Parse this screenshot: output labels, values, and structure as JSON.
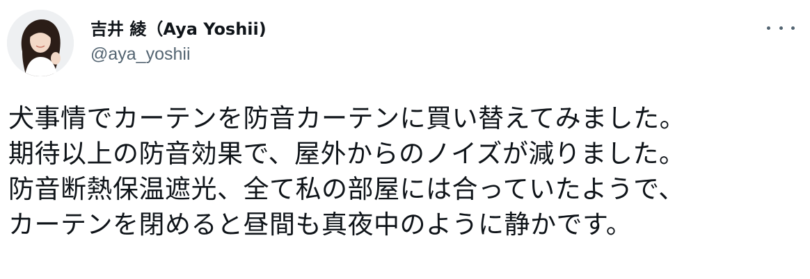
{
  "author": {
    "display_name": "吉井 綾（Aya Yoshii)",
    "handle": "@aya_yoshii"
  },
  "icons": {
    "avatar": "profile-photo",
    "more": "more-horizontal-icon"
  },
  "tweet": {
    "lines": [
      "犬事情でカーテンを防音カーテンに買い替えてみました。",
      "期待以上の防音効果で、屋外からのノイズが減りました。",
      "防音断熱保温遮光、全て私の部屋には合っていたようで、",
      "カーテンを閉めると昼間も真夜中のように静かです。"
    ]
  },
  "colors": {
    "text": "#0f1419",
    "secondary": "#536471",
    "background": "#ffffff"
  }
}
